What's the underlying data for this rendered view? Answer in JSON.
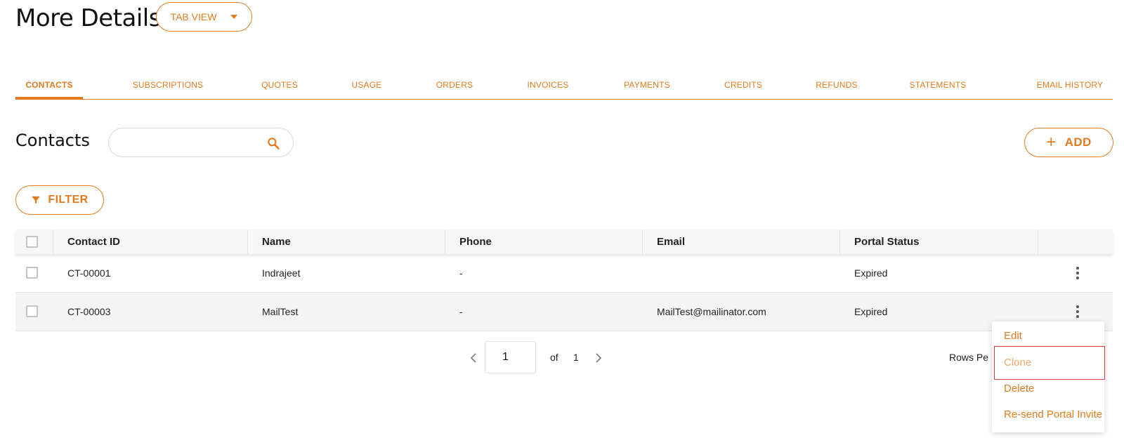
{
  "header": {
    "title": "More Details",
    "view_button": "TAB VIEW"
  },
  "tabs": [
    {
      "label": "CONTACTS",
      "active": true
    },
    {
      "label": "SUBSCRIPTIONS"
    },
    {
      "label": "QUOTES"
    },
    {
      "label": "USAGE"
    },
    {
      "label": "ORDERS"
    },
    {
      "label": "INVOICES"
    },
    {
      "label": "PAYMENTS"
    },
    {
      "label": "CREDITS"
    },
    {
      "label": "REFUNDS"
    },
    {
      "label": "STATEMENTS"
    },
    {
      "label": "EMAIL HISTORY"
    }
  ],
  "contacts": {
    "title": "Contacts",
    "search": {
      "value": "",
      "placeholder": ""
    },
    "add_label": "ADD",
    "filter_label": "FILTER"
  },
  "table": {
    "columns": [
      "Contact ID",
      "Name",
      "Phone",
      "Email",
      "Portal Status"
    ],
    "rows": [
      {
        "id": "CT-00001",
        "name": "Indrajeet",
        "phone": "-",
        "email": "",
        "status": "Expired"
      },
      {
        "id": "CT-00003",
        "name": "MailTest",
        "phone": "-",
        "email": "MailTest@mailinator.com",
        "status": "Expired"
      }
    ]
  },
  "pagination": {
    "current_page": "1",
    "of_label": "of",
    "total_pages": "1",
    "rows_per_page_label": "Rows Pe"
  },
  "row_menu": {
    "items": [
      "Edit",
      "Clone",
      "Delete",
      "Re-send Portal Invite"
    ],
    "highlighted": "Clone"
  },
  "colors": {
    "accent": "#e37b1e",
    "highlight_border": "#e23b3b"
  }
}
